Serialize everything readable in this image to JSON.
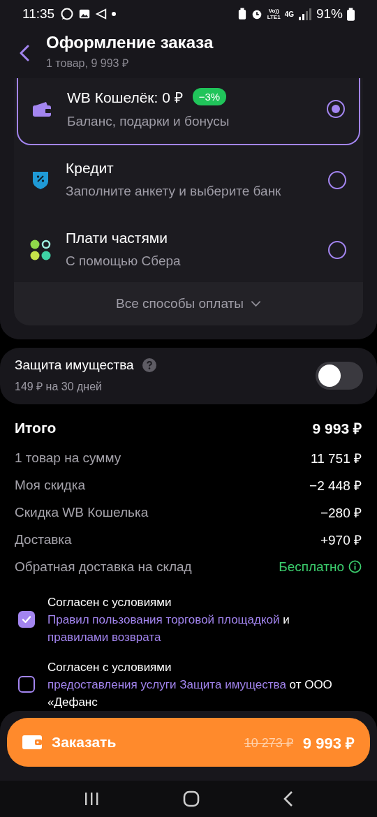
{
  "status_bar": {
    "time": "11:35",
    "volte": "Vo))",
    "lte": "LTE1",
    "network": "4G",
    "battery": "91%"
  },
  "header": {
    "title": "Оформление заказа",
    "subtitle": "1 товар, 9 993 ₽"
  },
  "payment_methods": [
    {
      "kind": "wallet",
      "title": "WB Кошелёк: 0 ₽",
      "badge": "−3%",
      "subtitle": "Баланс, подарки и бонусы",
      "selected": true
    },
    {
      "kind": "credit",
      "title": "Кредит",
      "subtitle": "Заполните анкету и выберите банк",
      "selected": false
    },
    {
      "kind": "installments",
      "title": "Плати частями",
      "subtitle": "С помощью Сбера",
      "selected": false
    }
  ],
  "all_methods": "Все способы оплаты",
  "protection": {
    "title": "Защита имущества",
    "subtitle": "149 ₽ на 30 дней",
    "on": false
  },
  "summary": {
    "total_label": "Итого",
    "total": "9 993 ₽",
    "rows": [
      {
        "kind": "plain",
        "label": "1 товар на сумму",
        "value": "11 751 ₽"
      },
      {
        "kind": "plain",
        "label": "Моя скидка",
        "value": "−2 448 ₽"
      },
      {
        "kind": "plain",
        "label": "Скидка WB Кошелька",
        "value": "−280 ₽"
      },
      {
        "kind": "plain",
        "label": "Доставка",
        "value": "+970 ₽"
      },
      {
        "kind": "free",
        "label": "Обратная доставка на склад",
        "value": "Бесплатно"
      }
    ]
  },
  "agreements": [
    {
      "checked": true,
      "parts": [
        {
          "text": "Согласен с условиями ",
          "link": false
        },
        {
          "text": "Правил пользования ",
          "link": true
        },
        {
          "text": "торговой площадкой",
          "link": true
        },
        {
          "text": " и ",
          "link": false
        },
        {
          "text": "правилами возврата",
          "link": true
        }
      ]
    },
    {
      "checked": false,
      "parts": [
        {
          "text": "Согласен с условиями ",
          "link": false
        },
        {
          "text": "предоставления услуги ",
          "link": true
        },
        {
          "text": "Защита имущества",
          "link": true
        },
        {
          "text": " от ООО «Дефанс",
          "link": false
        }
      ]
    }
  ],
  "order_button": {
    "label": "Заказать",
    "old_price": "10 273 ₽",
    "price": "9 993 ₽"
  }
}
